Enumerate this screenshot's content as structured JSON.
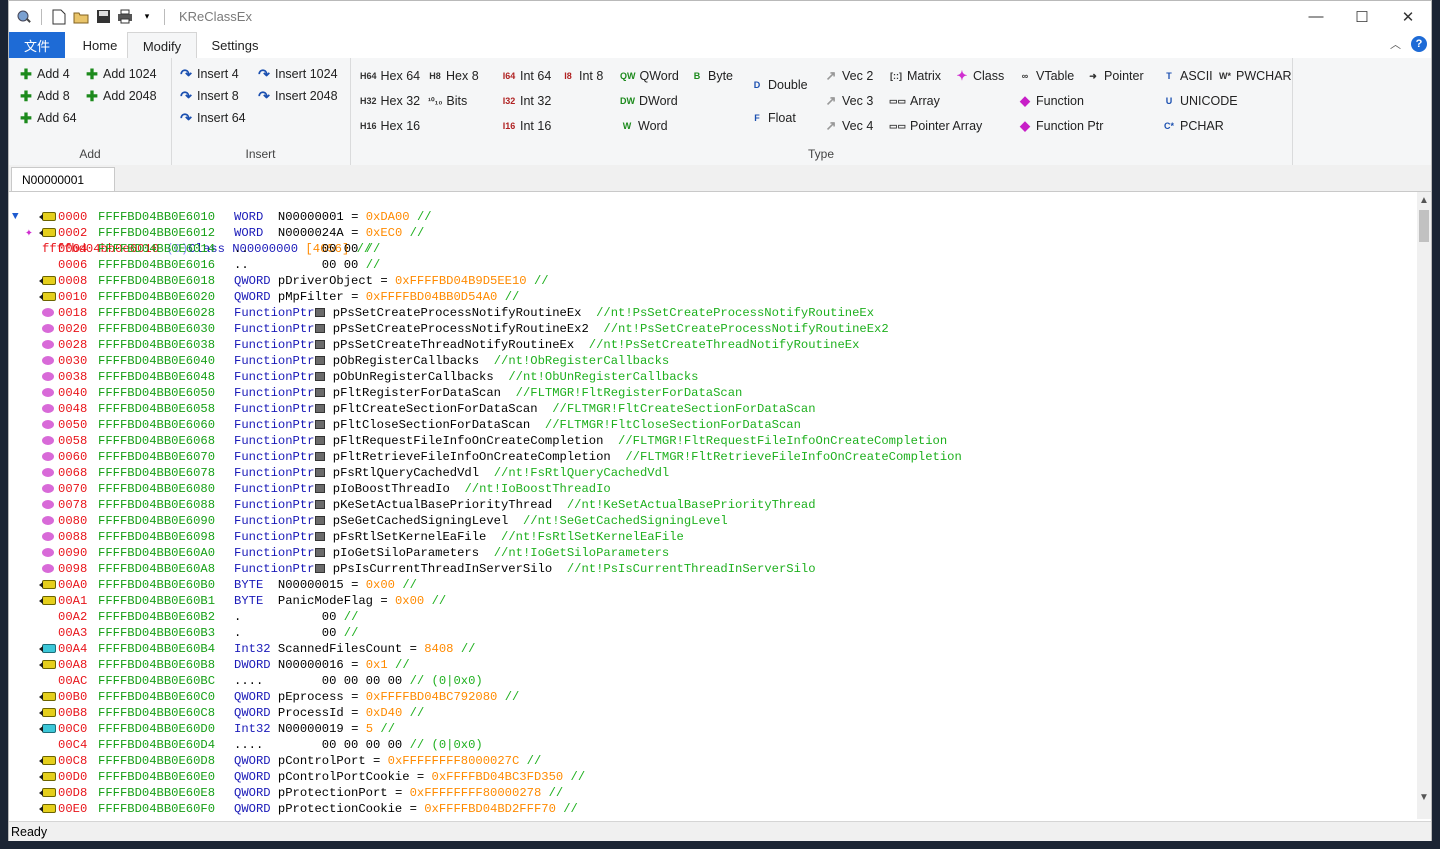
{
  "window": {
    "title": "KReClassEx",
    "controls": {
      "minimize": "—",
      "maximize": "☐",
      "close": "✕"
    }
  },
  "tabs": {
    "file": "文件",
    "home": "Home",
    "modify": "Modify",
    "settings": "Settings"
  },
  "ribbon": {
    "add": {
      "label": "Add",
      "add4": "Add 4",
      "add8": "Add 8",
      "add64": "Add 64",
      "add1024": "Add 1024",
      "add2048": "Add 2048"
    },
    "insert": {
      "label": "Insert",
      "insert4": "Insert 4",
      "insert8": "Insert 8",
      "insert64": "Insert 64",
      "insert1024": "Insert 1024",
      "insert2048": "Insert 2048"
    },
    "type": {
      "label": "Type",
      "hex64": "Hex 64",
      "hex32": "Hex 32",
      "hex16": "Hex 16",
      "hex8": "Hex 8",
      "bits": "Bits",
      "int64": "Int 64",
      "int32": "Int 32",
      "int16": "Int 16",
      "int8": "Int 8",
      "qword": "QWord",
      "dword": "DWord",
      "word": "Word",
      "byte": "Byte",
      "double": "Double",
      "float": "Float",
      "vec2": "Vec 2",
      "vec3": "Vec 3",
      "vec4": "Vec 4",
      "matrix": "Matrix",
      "array": "Array",
      "pointer_array": "Pointer Array",
      "class": "Class",
      "vtable": "VTable",
      "function": "Function",
      "function_ptr": "Function Ptr",
      "pointer": "Pointer",
      "ascii": "ASCII",
      "unicode": "UNICODE",
      "pchar": "PCHAR",
      "pwchar": "PWCHAR"
    }
  },
  "doc_tab": "N00000001",
  "header_row": {
    "address": "ffffbd04bb0e6010",
    "index": "(0)",
    "kind": "Class",
    "name": "N00000000",
    "size": "[4656]",
    "comment": "//"
  },
  "rows": [
    {
      "icon": "y",
      "off": "0000",
      "addr": "FFFFBD04BB0E6010",
      "type": "WORD",
      "name": "N00000001",
      "eq": "=",
      "val": "0xDA00",
      "cmt": "//"
    },
    {
      "icon": "y",
      "off": "0002",
      "addr": "FFFFBD04BB0E6012",
      "type": "WORD",
      "name": "N0000024A",
      "eq": "=",
      "val": "0xEC0",
      "cmt": "//"
    },
    {
      "icon": "",
      "off": "0004",
      "addr": "FFFFBD04BB0E6014",
      "type": "..",
      "name": "      00 00",
      "eq": "",
      "val": "",
      "cmt": "//"
    },
    {
      "icon": "",
      "off": "0006",
      "addr": "FFFFBD04BB0E6016",
      "type": "..",
      "name": "      00 00",
      "eq": "",
      "val": "",
      "cmt": "//"
    },
    {
      "icon": "y",
      "off": "0008",
      "addr": "FFFFBD04BB0E6018",
      "type": "QWORD",
      "name": "pDriverObject",
      "eq": "=",
      "val": "0xFFFFBD04B9D5EE10",
      "cmt": "//"
    },
    {
      "icon": "y",
      "off": "0010",
      "addr": "FFFFBD04BB0E6020",
      "type": "QWORD",
      "name": "pMpFilter",
      "eq": "=",
      "val": "0xFFFFBD04BB0D54A0",
      "cmt": "//"
    },
    {
      "icon": "p",
      "off": "0018",
      "addr": "FFFFBD04BB0E6028",
      "type": "FunctionPtr",
      "name": "pPsSetCreateProcessNotifyRoutineEx",
      "eq": "",
      "val": "",
      "cmt": "//nt!PsSetCreateProcessNotifyRoutineEx"
    },
    {
      "icon": "p",
      "off": "0020",
      "addr": "FFFFBD04BB0E6030",
      "type": "FunctionPtr",
      "name": "pPsSetCreateProcessNotifyRoutineEx2",
      "eq": "",
      "val": "",
      "cmt": "//nt!PsSetCreateProcessNotifyRoutineEx2"
    },
    {
      "icon": "p",
      "off": "0028",
      "addr": "FFFFBD04BB0E6038",
      "type": "FunctionPtr",
      "name": "pPsSetCreateThreadNotifyRoutineEx",
      "eq": "",
      "val": "",
      "cmt": "//nt!PsSetCreateThreadNotifyRoutineEx"
    },
    {
      "icon": "p",
      "off": "0030",
      "addr": "FFFFBD04BB0E6040",
      "type": "FunctionPtr",
      "name": "pObRegisterCallbacks",
      "eq": "",
      "val": "",
      "cmt": "//nt!ObRegisterCallbacks"
    },
    {
      "icon": "p",
      "off": "0038",
      "addr": "FFFFBD04BB0E6048",
      "type": "FunctionPtr",
      "name": "pObUnRegisterCallbacks",
      "eq": "",
      "val": "",
      "cmt": "//nt!ObUnRegisterCallbacks"
    },
    {
      "icon": "p",
      "off": "0040",
      "addr": "FFFFBD04BB0E6050",
      "type": "FunctionPtr",
      "name": "pFltRegisterForDataScan",
      "eq": "",
      "val": "",
      "cmt": "//FLTMGR!FltRegisterForDataScan"
    },
    {
      "icon": "p",
      "off": "0048",
      "addr": "FFFFBD04BB0E6058",
      "type": "FunctionPtr",
      "name": "pFltCreateSectionForDataScan",
      "eq": "",
      "val": "",
      "cmt": "//FLTMGR!FltCreateSectionForDataScan"
    },
    {
      "icon": "p",
      "off": "0050",
      "addr": "FFFFBD04BB0E6060",
      "type": "FunctionPtr",
      "name": "pFltCloseSectionForDataScan",
      "eq": "",
      "val": "",
      "cmt": "//FLTMGR!FltCloseSectionForDataScan"
    },
    {
      "icon": "p",
      "off": "0058",
      "addr": "FFFFBD04BB0E6068",
      "type": "FunctionPtr",
      "name": "pFltRequestFileInfoOnCreateCompletion",
      "eq": "",
      "val": "",
      "cmt": "//FLTMGR!FltRequestFileInfoOnCreateCompletion"
    },
    {
      "icon": "p",
      "off": "0060",
      "addr": "FFFFBD04BB0E6070",
      "type": "FunctionPtr",
      "name": "pFltRetrieveFileInfoOnCreateCompletion",
      "eq": "",
      "val": "",
      "cmt": "//FLTMGR!FltRetrieveFileInfoOnCreateCompletion"
    },
    {
      "icon": "p",
      "off": "0068",
      "addr": "FFFFBD04BB0E6078",
      "type": "FunctionPtr",
      "name": "pFsRtlQueryCachedVdl",
      "eq": "",
      "val": "",
      "cmt": "//nt!FsRtlQueryCachedVdl"
    },
    {
      "icon": "p",
      "off": "0070",
      "addr": "FFFFBD04BB0E6080",
      "type": "FunctionPtr",
      "name": "pIoBoostThreadIo",
      "eq": "",
      "val": "",
      "cmt": "//nt!IoBoostThreadIo"
    },
    {
      "icon": "p",
      "off": "0078",
      "addr": "FFFFBD04BB0E6088",
      "type": "FunctionPtr",
      "name": "pKeSetActualBasePriorityThread",
      "eq": "",
      "val": "",
      "cmt": "//nt!KeSetActualBasePriorityThread"
    },
    {
      "icon": "p",
      "off": "0080",
      "addr": "FFFFBD04BB0E6090",
      "type": "FunctionPtr",
      "name": "pSeGetCachedSigningLevel",
      "eq": "",
      "val": "",
      "cmt": "//nt!SeGetCachedSigningLevel"
    },
    {
      "icon": "p",
      "off": "0088",
      "addr": "FFFFBD04BB0E6098",
      "type": "FunctionPtr",
      "name": "pFsRtlSetKernelEaFile",
      "eq": "",
      "val": "",
      "cmt": "//nt!FsRtlSetKernelEaFile"
    },
    {
      "icon": "p",
      "off": "0090",
      "addr": "FFFFBD04BB0E60A0",
      "type": "FunctionPtr",
      "name": "pIoGetSiloParameters",
      "eq": "",
      "val": "",
      "cmt": "//nt!IoGetSiloParameters"
    },
    {
      "icon": "p",
      "off": "0098",
      "addr": "FFFFBD04BB0E60A8",
      "type": "FunctionPtr",
      "name": "pPsIsCurrentThreadInServerSilo",
      "eq": "",
      "val": "",
      "cmt": "//nt!PsIsCurrentThreadInServerSilo"
    },
    {
      "icon": "y",
      "off": "00A0",
      "addr": "FFFFBD04BB0E60B0",
      "type": "BYTE",
      "name": "N00000015",
      "eq": "=",
      "val": "0x00",
      "cmt": "//"
    },
    {
      "icon": "y",
      "off": "00A1",
      "addr": "FFFFBD04BB0E60B1",
      "type": "BYTE",
      "name": "PanicModeFlag",
      "eq": "=",
      "val": "0x00",
      "cmt": "//"
    },
    {
      "icon": "",
      "off": "00A2",
      "addr": "FFFFBD04BB0E60B2",
      "type": ".",
      "name": "      00",
      "eq": "",
      "val": "",
      "cmt": "//"
    },
    {
      "icon": "",
      "off": "00A3",
      "addr": "FFFFBD04BB0E60B3",
      "type": ".",
      "name": "      00",
      "eq": "",
      "val": "",
      "cmt": "//"
    },
    {
      "icon": "c",
      "off": "00A4",
      "addr": "FFFFBD04BB0E60B4",
      "type": "Int32",
      "name": "ScannedFilesCount",
      "eq": "=",
      "val": "8408",
      "cmt": "//"
    },
    {
      "icon": "y",
      "off": "00A8",
      "addr": "FFFFBD04BB0E60B8",
      "type": "DWORD",
      "name": "N00000016",
      "eq": "=",
      "val": "0x1",
      "cmt": "//"
    },
    {
      "icon": "",
      "off": "00AC",
      "addr": "FFFFBD04BB0E60BC",
      "type": "....",
      "name": "      00 00 00 00",
      "eq": "",
      "val": "",
      "cmt": "// (0|0x0)"
    },
    {
      "icon": "y",
      "off": "00B0",
      "addr": "FFFFBD04BB0E60C0",
      "type": "QWORD",
      "name": "pEprocess",
      "eq": "=",
      "val": "0xFFFFBD04BC792080",
      "cmt": "//"
    },
    {
      "icon": "y",
      "off": "00B8",
      "addr": "FFFFBD04BB0E60C8",
      "type": "QWORD",
      "name": "ProcessId",
      "eq": "=",
      "val": "0xD40",
      "cmt": "//"
    },
    {
      "icon": "c",
      "off": "00C0",
      "addr": "FFFFBD04BB0E60D0",
      "type": "Int32",
      "name": "N00000019",
      "eq": "=",
      "val": "5",
      "cmt": "//"
    },
    {
      "icon": "",
      "off": "00C4",
      "addr": "FFFFBD04BB0E60D4",
      "type": "....",
      "name": "      00 00 00 00",
      "eq": "",
      "val": "",
      "cmt": "// (0|0x0)"
    },
    {
      "icon": "y",
      "off": "00C8",
      "addr": "FFFFBD04BB0E60D8",
      "type": "QWORD",
      "name": "pControlPort",
      "eq": "=",
      "val": "0xFFFFFFFF8000027C",
      "cmt": "//"
    },
    {
      "icon": "y",
      "off": "00D0",
      "addr": "FFFFBD04BB0E60E0",
      "type": "QWORD",
      "name": "pControlPortCookie",
      "eq": "=",
      "val": "0xFFFFBD04BC3FD350",
      "cmt": "//"
    },
    {
      "icon": "y",
      "off": "00D8",
      "addr": "FFFFBD04BB0E60E8",
      "type": "QWORD",
      "name": "pProtectionPort",
      "eq": "=",
      "val": "0xFFFFFFFF80000278",
      "cmt": "//"
    },
    {
      "icon": "y",
      "off": "00E0",
      "addr": "FFFFBD04BB0E60F0",
      "type": "QWORD",
      "name": "pProtectionCookie",
      "eq": "=",
      "val": "0xFFFFBD04BD2FFF70",
      "cmt": "//"
    }
  ],
  "status": "Ready"
}
